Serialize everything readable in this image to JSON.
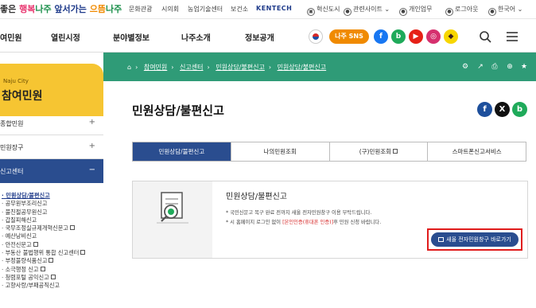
{
  "top": {
    "slogan": {
      "p1": "좋은 ",
      "p2": "행복",
      "p3": "나주",
      "p4": " 앞서가는 ",
      "p5": "으뜸",
      "p6": "나주"
    },
    "links": [
      "문화관광",
      "시의회",
      "농업기술센터",
      "보건소",
      "KENTECH",
      "혁신도시",
      "관련사이트",
      "개인업무",
      "로그아웃",
      "한국어"
    ]
  },
  "gnb": {
    "items": [
      "여민원",
      "열린시정",
      "분야별정보",
      "나주소개",
      "정보공개"
    ],
    "sns_label": "나주 SNS",
    "sns": [
      "f",
      "b",
      "▶",
      "◎",
      "◆"
    ]
  },
  "sidebar": {
    "en": "Naju City",
    "title": "참여민원",
    "menus": [
      "종합민원",
      "민원장구",
      "신고센터"
    ],
    "sub_items": [
      "· 민원상담/불편신고",
      "· 공무원부조리신고",
      "· 불친절공무원신고",
      "· 갑질피해신고",
      "· 국무조정실규제개혁신문고",
      "· 예산낭비신고",
      "· 안전신문고",
      "· 부동산 불법행위 통합 신고센터",
      "· 부정불량식품신고",
      "· 소극행정 신고",
      "· 청렴포털 공익신고",
      "· 고향사랑/부패공직신고"
    ]
  },
  "breadcrumb": [
    "참여민원",
    "신고센터",
    "민원상담/불편신고",
    "민원상담/불편신고"
  ],
  "page": {
    "title": "민원상담/불편신고"
  },
  "tabs": [
    "민원상담/불편신고",
    "나의민원조회",
    "(구)민원조회",
    "스마트폰신고서비스"
  ],
  "card": {
    "title": "민원상담/불편신고",
    "note1": "* 국민신문고 복구 완료 전까지 새올 전자민원창구 이용 부탁드립니다.",
    "note2a": "* 시 홈페이지 로그인 없이 ",
    "note2b": "[본인인증(휴대폰 인증)]",
    "note2c": "후 민원 신청 바랍니다.",
    "button": "새올 전자민원창구 바로가기"
  },
  "colors": {
    "accent": "#2a4d8f",
    "band": "#2f9b77",
    "side_head": "#f6c532",
    "highlight": "#e01c1c"
  }
}
